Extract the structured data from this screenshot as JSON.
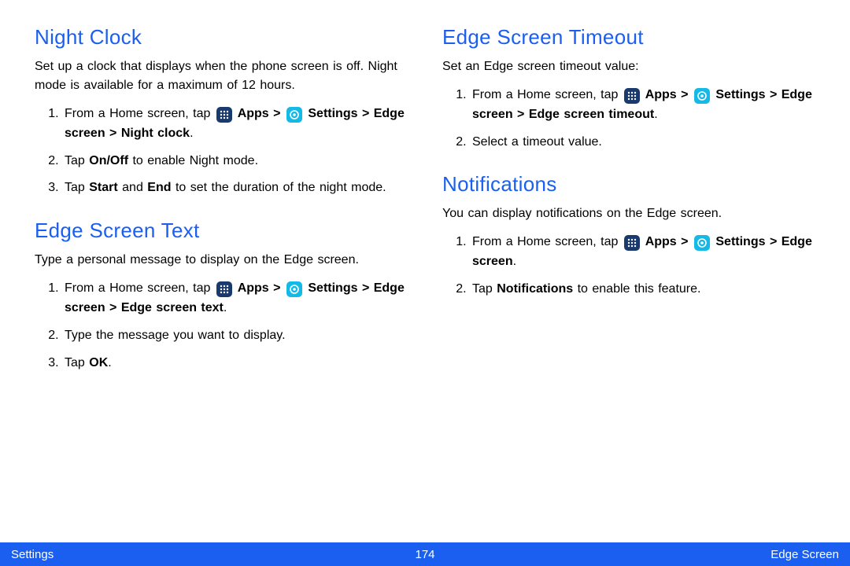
{
  "icons": {
    "apps_label": "Apps",
    "settings_label": "Settings"
  },
  "left": {
    "night_clock": {
      "heading": "Night Clock",
      "desc": "Set up a clock that displays when the phone screen is off. Night mode is available for a maximum of 12 hours.",
      "step1_prefix": "From a Home screen, tap ",
      "step1_apps": " Apps > ",
      "step1_settings": " Settings > Edge screen > Night clock",
      "step1_tail": ".",
      "step2_a": "Tap ",
      "step2_b": "On/Off",
      "step2_c": " to enable Night mode.",
      "step3_a": "Tap ",
      "step3_b": "Start",
      "step3_c": " and ",
      "step3_d": "End",
      "step3_e": " to set the duration of the night mode."
    },
    "edge_text": {
      "heading": "Edge Screen Text",
      "desc": "Type a personal message to display on the Edge screen.",
      "step1_prefix": "From a Home screen, tap ",
      "step1_apps": " Apps > ",
      "step1_settings": " Settings > Edge screen > Edge screen text",
      "step1_tail": ".",
      "step2": "Type the message you want to display.",
      "step3_a": "Tap ",
      "step3_b": "OK",
      "step3_c": "."
    }
  },
  "right": {
    "timeout": {
      "heading": "Edge Screen Timeout",
      "desc": "Set an Edge screen timeout value:",
      "step1_prefix": "From a Home screen, tap ",
      "step1_apps": " Apps > ",
      "step1_settings": " Settings > Edge screen > Edge screen timeout",
      "step1_tail": ".",
      "step2": "Select a timeout value."
    },
    "notifications": {
      "heading": "Notifications",
      "desc": "You can display notifications on the Edge screen.",
      "step1_prefix": "From a Home screen, tap ",
      "step1_apps": " Apps > ",
      "step1_settings": " Settings > Edge screen",
      "step1_tail": ".",
      "step2_a": "Tap ",
      "step2_b": "Notifications",
      "step2_c": " to enable this feature."
    }
  },
  "footer": {
    "left": "Settings",
    "center": "174",
    "right": "Edge Screen"
  }
}
